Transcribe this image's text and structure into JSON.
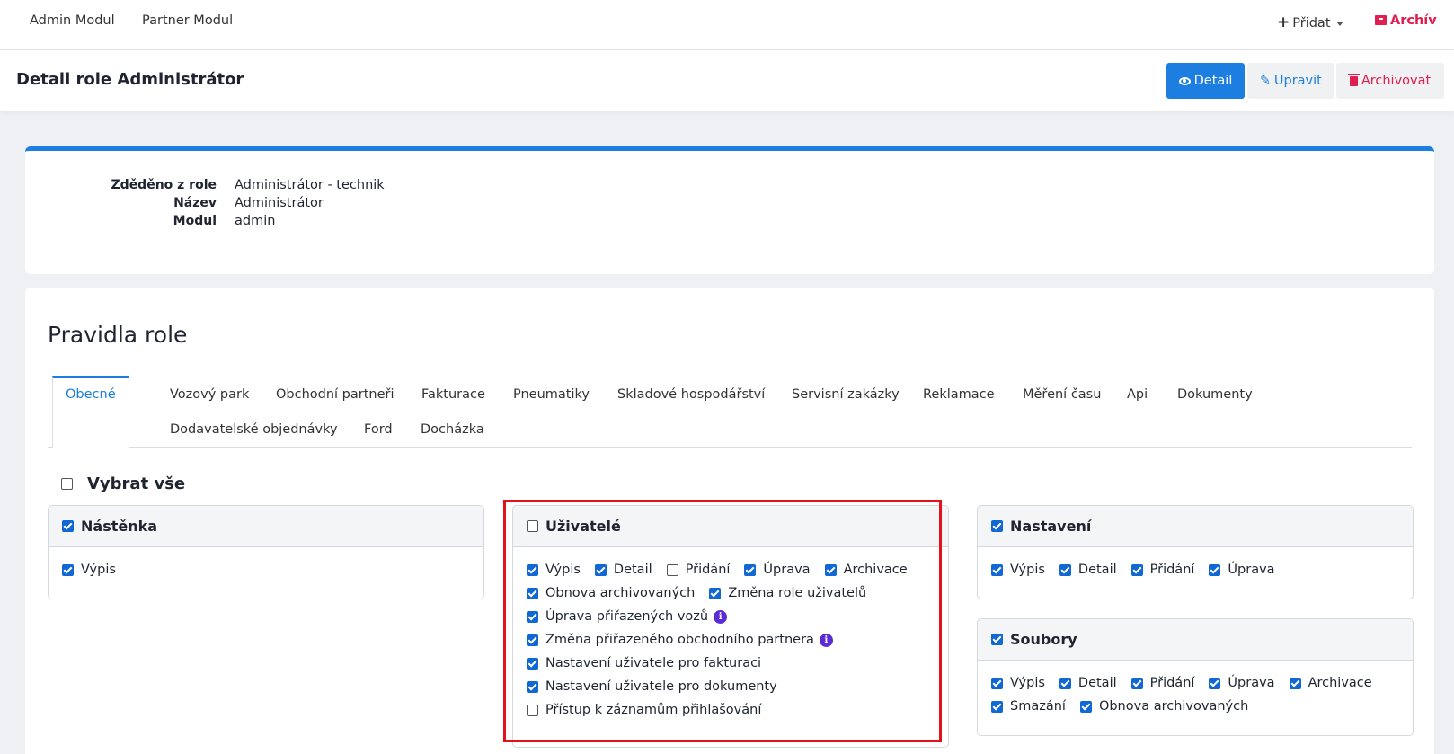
{
  "topnav": {
    "admin_modul": "Admin Modul",
    "partner_modul": "Partner Modul",
    "pridat": "Přidat",
    "archiv": "Archív"
  },
  "header": {
    "title": "Detail role Administrátor",
    "btn_detail": "Detail",
    "btn_upravit": "Upravit",
    "btn_archivovat": "Archivovat"
  },
  "info": [
    {
      "key": "Zděděno z role",
      "value": "Administrátor - technik"
    },
    {
      "key": "Název",
      "value": "Administrátor"
    },
    {
      "key": "Modul",
      "value": "admin"
    }
  ],
  "rules": {
    "title": "Pravidla role",
    "tabs": [
      "Obecné",
      "Vozový park",
      "Obchodní partneři",
      "Fakturace",
      "Pneumatiky",
      "Skladové hospodářství",
      "Servisní zakázky",
      "Reklamace",
      "Měření času",
      "Api",
      "Dokumenty",
      "Dodavatelské objednávky",
      "Ford",
      "Docházka"
    ],
    "select_all": "Vybrat vše"
  },
  "panels": {
    "nastenka": {
      "title": "Nástěnka",
      "checked": true,
      "items": [
        {
          "label": "Výpis",
          "checked": true
        }
      ]
    },
    "uzivatele": {
      "title": "Uživatelé",
      "checked": false,
      "items": [
        {
          "label": "Výpis",
          "checked": true
        },
        {
          "label": "Detail",
          "checked": true
        },
        {
          "label": "Přidání",
          "checked": false
        },
        {
          "label": "Úprava",
          "checked": true
        },
        {
          "label": "Archivace",
          "checked": true
        },
        {
          "label": "Obnova archivovaných",
          "checked": true
        },
        {
          "label": "Změna role uživatelů",
          "checked": true
        },
        {
          "label": "Úprava přiřazených vozů",
          "checked": true
        },
        {
          "label": "Změna přiřazeného obchodního partnera",
          "checked": true
        },
        {
          "label": "Nastavení uživatele pro fakturaci",
          "checked": true
        },
        {
          "label": "Nastavení uživatele pro dokumenty",
          "checked": true
        },
        {
          "label": "Přístup k záznamům přihlašování",
          "checked": false
        }
      ]
    },
    "nastaveni": {
      "title": "Nastavení",
      "checked": true,
      "items": [
        {
          "label": "Výpis",
          "checked": true
        },
        {
          "label": "Detail",
          "checked": true
        },
        {
          "label": "Přidání",
          "checked": true
        },
        {
          "label": "Úprava",
          "checked": true
        }
      ]
    },
    "soubory": {
      "title": "Soubory",
      "checked": true,
      "items": [
        {
          "label": "Výpis",
          "checked": true
        },
        {
          "label": "Detail",
          "checked": true
        },
        {
          "label": "Přidání",
          "checked": true
        },
        {
          "label": "Úprava",
          "checked": true
        },
        {
          "label": "Archivace",
          "checked": true
        },
        {
          "label": "Smazání",
          "checked": true
        },
        {
          "label": "Obnova archivovaných",
          "checked": true
        }
      ]
    }
  },
  "colors": {
    "primary": "#1c7ee0",
    "danger": "#e01e4f",
    "highlight": "#e3131e",
    "info": "#5b2bd6"
  }
}
